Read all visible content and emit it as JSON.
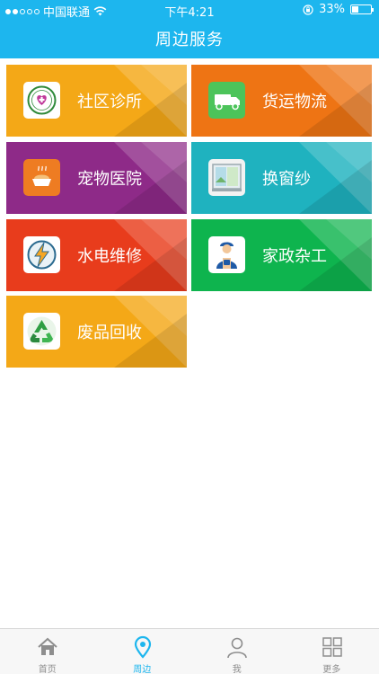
{
  "status_bar": {
    "carrier": "中国联通",
    "time": "下午4:21",
    "battery": "33%",
    "battery_level": 0.33
  },
  "header": {
    "title": "周边服务"
  },
  "services": [
    {
      "label": "社区诊所",
      "icon": "clinic-icon",
      "color": "#f4a817"
    },
    {
      "label": "货运物流",
      "icon": "truck-icon",
      "color": "#ee7414"
    },
    {
      "label": "宠物医院",
      "icon": "pet-food-icon",
      "color": "#8e2a88"
    },
    {
      "label": "换窗纱",
      "icon": "window-icon",
      "color": "#1fb2bf"
    },
    {
      "label": "水电维修",
      "icon": "lightning-icon",
      "color": "#e83c1c"
    },
    {
      "label": "家政杂工",
      "icon": "worker-icon",
      "color": "#0eb44e"
    },
    {
      "label": "废品回收",
      "icon": "recycle-icon",
      "color": "#f4a817"
    }
  ],
  "tabs": [
    {
      "label": "首页",
      "icon": "home-icon",
      "active": false
    },
    {
      "label": "周边",
      "icon": "location-pin-icon",
      "active": true
    },
    {
      "label": "我",
      "icon": "user-icon",
      "active": false
    },
    {
      "label": "更多",
      "icon": "grid-icon",
      "active": false
    }
  ],
  "colors": {
    "accent": "#1db6ee",
    "tab_inactive": "#8e8e8e"
  }
}
